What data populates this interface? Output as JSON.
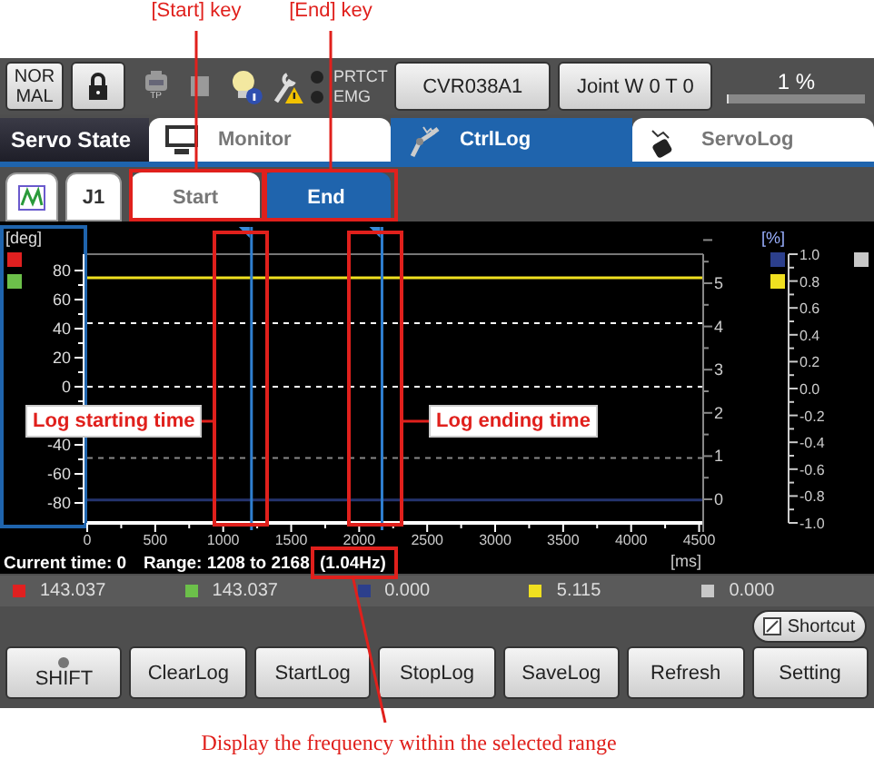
{
  "annotations": [
    {
      "kind": "key_label",
      "text": "[Start] key"
    },
    {
      "kind": "key_label",
      "text": "[End] key"
    },
    {
      "kind": "callout",
      "text": "Log starting time"
    },
    {
      "kind": "callout",
      "text": "Log ending time"
    },
    {
      "kind": "caption",
      "text": "Display the frequency within the selected range"
    }
  ],
  "status_bar": {
    "mode": "NOR MAL",
    "tp_label": "TP",
    "indicators": [
      {
        "label": "PRTCT",
        "lit": false
      },
      {
        "label": "EMG",
        "lit": false
      }
    ],
    "buttons": [
      "CVR038A1",
      "Joint W 0 T 0"
    ],
    "speed": {
      "value": "1 %",
      "level": 0.01
    }
  },
  "header": {
    "title": "Servo State",
    "tabs": [
      {
        "label": "Monitor",
        "selected": false
      },
      {
        "label": "CtrlLog",
        "selected": true
      },
      {
        "label": "ServoLog",
        "selected": false
      }
    ]
  },
  "toolbar": {
    "axis_button": "J1",
    "range_keys": [
      {
        "label": "Start",
        "selected": false
      },
      {
        "label": "End",
        "selected": true
      }
    ]
  },
  "chart": {
    "left_swatches": [
      {
        "color": "#e02020"
      },
      {
        "color": "#6cc04a"
      }
    ],
    "right_axis": {
      "ticks": [
        "5",
        "4",
        "3",
        "2",
        "1",
        "0"
      ]
    },
    "percent_axis": {
      "label": "[%]",
      "ticks": [
        "1.0",
        "0.8",
        "0.6",
        "0.4",
        "0.2",
        "0.0",
        "-0.2",
        "-0.4",
        "-0.6",
        "-0.8",
        "-1.0"
      ]
    },
    "right_swatches": [
      {
        "color": "#2c3f8c"
      },
      {
        "color": "#f0e020"
      },
      {
        "color": "#c8c8c8"
      }
    ],
    "chart_data": {
      "type": "line",
      "xlabel": "[ms]",
      "ylabel": "[deg]",
      "x": [
        0,
        4530
      ],
      "xlim": [
        0,
        4530
      ],
      "ylim": [
        -93.75,
        91.25
      ],
      "xticks": [
        {
          "value": 0,
          "label": "0"
        },
        {
          "value": 500,
          "label": "500"
        },
        {
          "value": 1000,
          "label": "1000"
        },
        {
          "value": 1500,
          "label": "1500"
        },
        {
          "value": 2000,
          "label": "2000"
        },
        {
          "value": 2500,
          "label": "2500"
        },
        {
          "value": 3000,
          "label": "3000"
        },
        {
          "value": 3500,
          "label": "3500"
        },
        {
          "value": 4000,
          "label": "4000"
        },
        {
          "value": 4500,
          "label": "4500"
        }
      ],
      "yticks": [
        {
          "value": 80,
          "label": "80"
        },
        {
          "value": 60,
          "label": "60"
        },
        {
          "value": 40,
          "label": "40"
        },
        {
          "value": 20,
          "label": "20"
        },
        {
          "value": 0,
          "label": "0"
        },
        {
          "value": -40,
          "label": "-40"
        },
        {
          "value": -60,
          "label": "-60"
        },
        {
          "value": -80,
          "label": "-80"
        }
      ],
      "series": [
        {
          "color": "#f0e020",
          "values": [
            75,
            75
          ]
        },
        {
          "color": "#24346e",
          "values": [
            -78,
            -78
          ]
        }
      ],
      "ref_lines": [
        {
          "axis": "x",
          "value": 1208
        },
        {
          "axis": "x",
          "value": 2168
        },
        {
          "axis": "y",
          "value": -49
        }
      ]
    },
    "current_time": "Current time: 0",
    "range": "Range: 1208 to 2168",
    "frequency": "(1.04Hz)"
  },
  "legend": [
    {
      "color": "#e02020",
      "value": "143.037"
    },
    {
      "color": "#6cc04a",
      "value": "143.037"
    },
    {
      "color": "#2c3f8c",
      "value": "0.000"
    },
    {
      "color": "#f0e020",
      "value": "5.115"
    },
    {
      "color": "#c8c8c8",
      "value": "0.000"
    }
  ],
  "shortcut": "Shortcut",
  "buttons": [
    {
      "kind": "shift",
      "label": "SHIFT"
    },
    {
      "kind": "plain",
      "label": "ClearLog"
    },
    {
      "kind": "plain",
      "label": "StartLog"
    },
    {
      "kind": "plain",
      "label": "StopLog"
    },
    {
      "kind": "plain",
      "label": "SaveLog"
    },
    {
      "kind": "plain",
      "label": "Refresh"
    },
    {
      "kind": "plain",
      "label": "Setting"
    }
  ]
}
